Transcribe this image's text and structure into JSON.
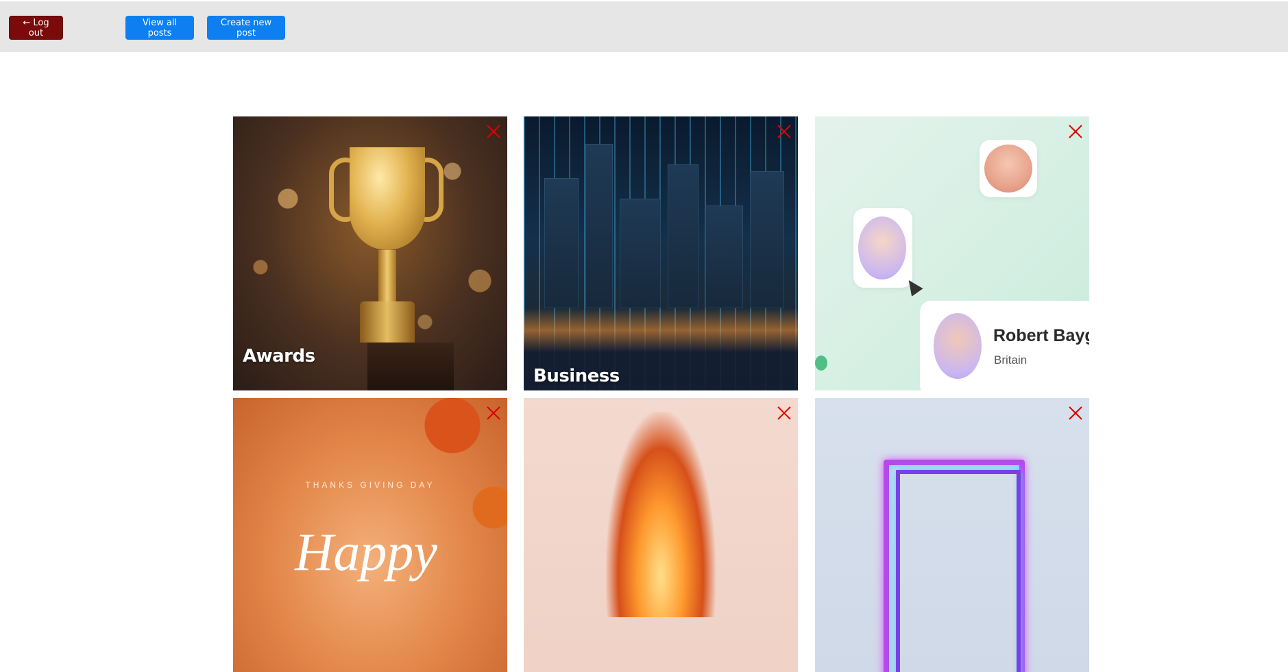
{
  "header": {
    "logout_label": "← Log out",
    "view_all_label": "View all posts",
    "create_label": "Create new post"
  },
  "posts": [
    {
      "caption": "Awards",
      "topic": "trophy"
    },
    {
      "caption": "Business",
      "topic": "city skyline"
    },
    {
      "caption": "",
      "topic": "people profiles",
      "profile_name": "Robert Baygulo",
      "profile_country": "Britain"
    },
    {
      "caption": "",
      "topic": "thanksgiving",
      "small_text": "THANKS GIVING DAY",
      "big_text": "Happy"
    },
    {
      "caption": "",
      "topic": "fire"
    },
    {
      "caption": "",
      "topic": "neon frame"
    }
  ],
  "colors": {
    "logout_bg": "#7b0b0b",
    "primary_button_bg": "#0d7ff0",
    "header_bg": "#e6e6e6",
    "delete_icon": "#e00000"
  }
}
